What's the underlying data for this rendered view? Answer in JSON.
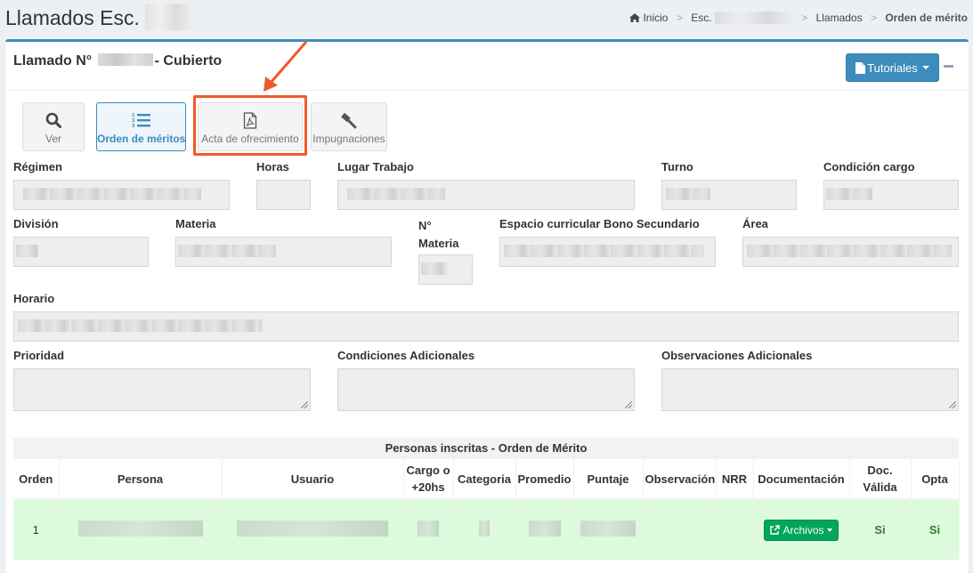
{
  "page": {
    "title": "Llamados Esc.",
    "breadcrumb": [
      "Inicio",
      "Esc.",
      "Llamados",
      "Orden de mérito"
    ]
  },
  "box": {
    "title_prefix": "Llamado N°",
    "title_suffix": "- Cubierto",
    "tutorials_label": "Tutoriales"
  },
  "toolbar": {
    "ver": "Ver",
    "orden_meritos": "Orden de méritos",
    "acta": "Acta de ofrecimiento",
    "impugnaciones": "Impugnaciones"
  },
  "fields": {
    "regimen": "Régimen",
    "horas": "Horas",
    "lugar_trabajo": "Lugar Trabajo",
    "turno": "Turno",
    "condicion_cargo": "Condición cargo",
    "division": "División",
    "materia": "Materia",
    "n_materia_1": "N°",
    "n_materia_2": "Materia",
    "espacio_curricular": "Espacio curricular Bono Secundario",
    "area": "Área",
    "horario": "Horario",
    "prioridad": "Prioridad",
    "condiciones_adicionales": "Condiciones Adicionales",
    "observaciones_adicionales": "Observaciones Adicionales"
  },
  "table": {
    "caption": "Personas inscritas - Orden de Mérito",
    "headers": {
      "orden": "Orden",
      "persona": "Persona",
      "usuario": "Usuario",
      "cargo_1": "Cargo o",
      "cargo_2": "+20hs",
      "categoria": "Categoria",
      "promedio": "Promedio",
      "puntaje": "Puntaje",
      "observacion": "Observación",
      "nrr": "NRR",
      "documentacion": "Documentación",
      "doc_valida_1": "Doc.",
      "doc_valida_2": "Válida",
      "opta": "Opta"
    },
    "rows": [
      {
        "orden": "1",
        "archivos_label": "Archivos",
        "doc_valida": "Si",
        "opta": "Si"
      }
    ]
  },
  "colors": {
    "primary": "#3c8dbc",
    "success": "#00a65a",
    "highlight": "#ee5a2a",
    "row_bg": "#dcfadc"
  },
  "icons": [
    "home-icon",
    "search-icon",
    "ordered-list-icon",
    "pdf-file-icon",
    "gavel-icon",
    "file-icon",
    "external-link-icon"
  ]
}
